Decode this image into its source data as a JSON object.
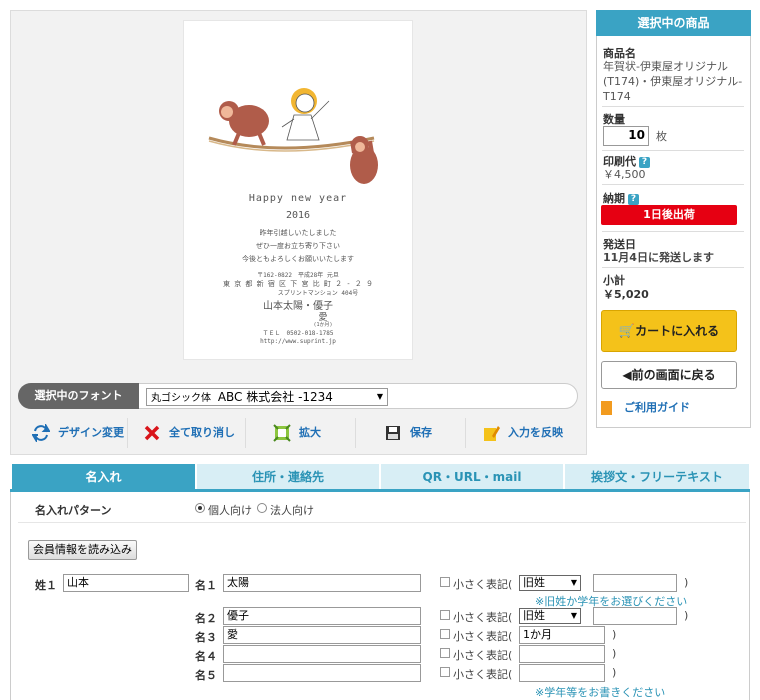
{
  "card": {
    "greeting": "Happy new year",
    "year": "2016",
    "lines": [
      "昨年引越しいたしました",
      "ぜひ一度お立ち寄り下さい",
      "今後ともよろしくお願いいたします"
    ],
    "postal": "〒162-0822　平成28年 元旦",
    "address1": "東 京 都 新 宿 区 下 宮 比 町 ２ - ２ ９",
    "address2": "スプリントマンション 404号",
    "names": "山本太陽・優子",
    "child": "愛",
    "child_note": "(1か月)",
    "tel": "ＴＥＬ　0502-018-1785",
    "url": "http://www.suprint.jp"
  },
  "font": {
    "label": "選択中のフォント",
    "selected_prefix": "丸ゴシック体",
    "selected_sample": "ABC 株式会社 -1234"
  },
  "toolbar": {
    "design": "デザイン変更",
    "cancel_all": "全て取り消し",
    "zoom": "拡大",
    "save": "保存",
    "apply_input": "入力を反映"
  },
  "sidebar": {
    "header": "選択中の商品",
    "product_label": "商品名",
    "product_name": "年賀状-伊東屋オリジナル(T174)・伊東屋オリジナル-T174",
    "quantity_label": "数量",
    "quantity_value": "10",
    "quantity_unit": "枚",
    "print_fee_label": "印刷代",
    "print_fee_value": "￥4,500",
    "delivery_label": "納期",
    "delivery_badge": "1日後出荷",
    "ship_label": "発送日",
    "ship_value": "11月4日に発送します",
    "subtotal_label": "小計",
    "subtotal_value": "￥5,020",
    "cart_button": "カートに入れる",
    "back_button": "前の画面に戻る",
    "guide_link": "ご利用ガイド",
    "help_mark": "?"
  },
  "tabs": [
    {
      "label": "名入れ",
      "active": true
    },
    {
      "label": "住所・連絡先",
      "active": false
    },
    {
      "label": "QR・URL・mail",
      "active": false
    },
    {
      "label": "挨拶文・フリーテキスト",
      "active": false
    }
  ],
  "form": {
    "pattern_label": "名入れパターン",
    "pattern_personal": "個人向け",
    "pattern_corporate": "法人向け",
    "load_member_button": "会員情報を読み込み",
    "surname_label": "姓１",
    "surname_value": "山本",
    "names": [
      {
        "label": "名１",
        "value": "太陽",
        "small": "小さく表記(",
        "select": "旧姓",
        "extra": ""
      },
      {
        "label": "名２",
        "value": "優子",
        "small": "小さく表記(",
        "select": "旧姓",
        "extra": ""
      },
      {
        "label": "名３",
        "value": "愛",
        "small": "小さく表記(",
        "text": "1か月"
      },
      {
        "label": "名４",
        "value": "",
        "small": "小さく表記(",
        "text": ""
      },
      {
        "label": "名５",
        "value": "",
        "small": "小さく表記(",
        "text": ""
      }
    ],
    "close_paren": ")",
    "note_old_name": "※旧姓か学年をお選びください",
    "note_grade": "※学年等をお書きください"
  },
  "colors": {
    "accent": "#3aa3c4",
    "cart_yellow": "#f4c21a",
    "badge_red": "#e60012",
    "link_blue": "#1f6fb5"
  }
}
